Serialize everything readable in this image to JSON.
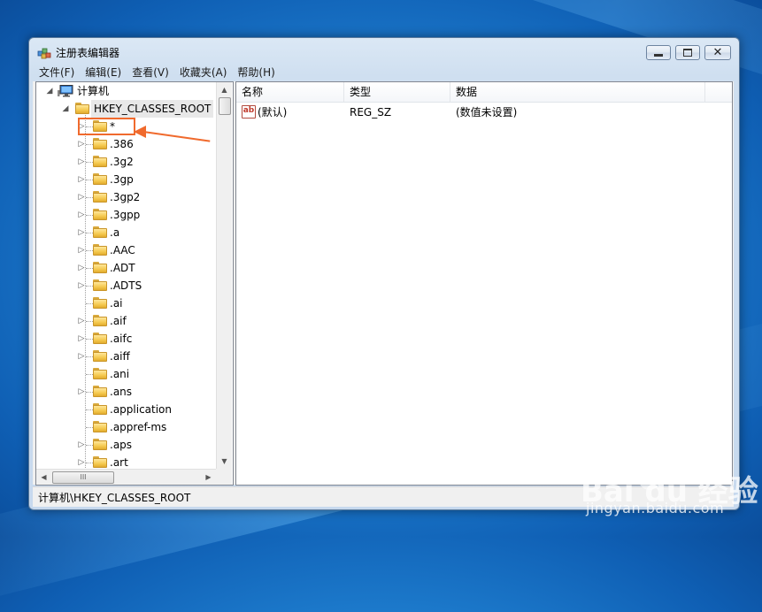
{
  "window": {
    "title": "注册表编辑器",
    "close_glyph": "✕"
  },
  "menu": [
    "文件(F)",
    "编辑(E)",
    "查看(V)",
    "收藏夹(A)",
    "帮助(H)"
  ],
  "tree": {
    "root_label": "计算机",
    "hive_label": "HKEY_CLASSES_ROOT",
    "items": [
      {
        "label": "*",
        "expandable": true
      },
      {
        "label": ".386",
        "expandable": true
      },
      {
        "label": ".3g2",
        "expandable": true
      },
      {
        "label": ".3gp",
        "expandable": true
      },
      {
        "label": ".3gp2",
        "expandable": true
      },
      {
        "label": ".3gpp",
        "expandable": true
      },
      {
        "label": ".a",
        "expandable": true
      },
      {
        "label": ".AAC",
        "expandable": true
      },
      {
        "label": ".ADT",
        "expandable": true
      },
      {
        "label": ".ADTS",
        "expandable": true
      },
      {
        "label": ".ai",
        "expandable": false
      },
      {
        "label": ".aif",
        "expandable": true
      },
      {
        "label": ".aifc",
        "expandable": true
      },
      {
        "label": ".aiff",
        "expandable": true
      },
      {
        "label": ".ani",
        "expandable": false
      },
      {
        "label": ".ans",
        "expandable": true
      },
      {
        "label": ".application",
        "expandable": false
      },
      {
        "label": ".appref-ms",
        "expandable": false
      },
      {
        "label": ".aps",
        "expandable": true
      },
      {
        "label": ".art",
        "expandable": true
      }
    ],
    "hscroll_grip": "III"
  },
  "list": {
    "columns": [
      "名称",
      "类型",
      "数据"
    ],
    "rows": [
      {
        "icon": "ab",
        "name": "(默认)",
        "type": "REG_SZ",
        "data": "(数值未设置)"
      }
    ]
  },
  "status": {
    "path": "计算机\\HKEY_CLASSES_ROOT"
  },
  "watermark": {
    "brand": "Bai du 经验",
    "url": "jingyan.baidu.com"
  },
  "colors": {
    "annotation": "#f06a2d",
    "desktop": "#1f7fd0"
  }
}
